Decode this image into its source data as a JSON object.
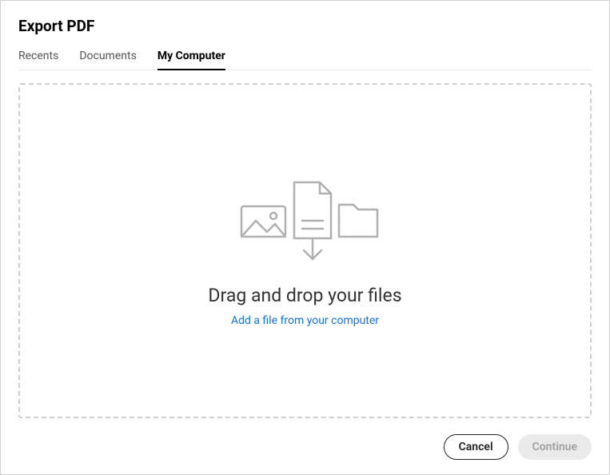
{
  "header": {
    "title": "Export PDF"
  },
  "tabs": {
    "recents": "Recents",
    "documents": "Documents",
    "my_computer": "My Computer"
  },
  "dropzone": {
    "prompt": "Drag and drop your files",
    "add_link": "Add a file from your computer"
  },
  "footer": {
    "cancel": "Cancel",
    "continue": "Continue"
  }
}
